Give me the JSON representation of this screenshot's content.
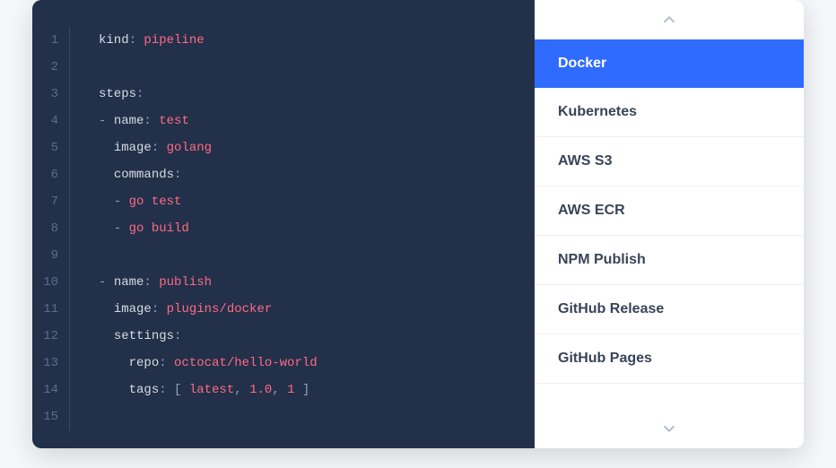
{
  "editor": {
    "lines": [
      [
        {
          "t": "key",
          "v": "kind"
        },
        {
          "t": "punc",
          "v": ": "
        },
        {
          "t": "val",
          "v": "pipeline"
        }
      ],
      [],
      [
        {
          "t": "key",
          "v": "steps"
        },
        {
          "t": "punc",
          "v": ":"
        }
      ],
      [
        {
          "t": "dash",
          "v": "- "
        },
        {
          "t": "key",
          "v": "name"
        },
        {
          "t": "punc",
          "v": ": "
        },
        {
          "t": "val",
          "v": "test"
        }
      ],
      [
        {
          "t": "pad",
          "v": "  "
        },
        {
          "t": "key",
          "v": "image"
        },
        {
          "t": "punc",
          "v": ": "
        },
        {
          "t": "val",
          "v": "golang"
        }
      ],
      [
        {
          "t": "pad",
          "v": "  "
        },
        {
          "t": "key",
          "v": "commands"
        },
        {
          "t": "punc",
          "v": ":"
        }
      ],
      [
        {
          "t": "pad",
          "v": "  "
        },
        {
          "t": "dash",
          "v": "- "
        },
        {
          "t": "val",
          "v": "go test"
        }
      ],
      [
        {
          "t": "pad",
          "v": "  "
        },
        {
          "t": "dash",
          "v": "- "
        },
        {
          "t": "val",
          "v": "go build"
        }
      ],
      [],
      [
        {
          "t": "dash",
          "v": "- "
        },
        {
          "t": "key",
          "v": "name"
        },
        {
          "t": "punc",
          "v": ": "
        },
        {
          "t": "val",
          "v": "publish"
        }
      ],
      [
        {
          "t": "pad",
          "v": "  "
        },
        {
          "t": "key",
          "v": "image"
        },
        {
          "t": "punc",
          "v": ": "
        },
        {
          "t": "val",
          "v": "plugins/docker"
        }
      ],
      [
        {
          "t": "pad",
          "v": "  "
        },
        {
          "t": "key",
          "v": "settings"
        },
        {
          "t": "punc",
          "v": ":"
        }
      ],
      [
        {
          "t": "pad",
          "v": "    "
        },
        {
          "t": "key",
          "v": "repo"
        },
        {
          "t": "punc",
          "v": ": "
        },
        {
          "t": "val",
          "v": "octocat/hello-world"
        }
      ],
      [
        {
          "t": "pad",
          "v": "    "
        },
        {
          "t": "key",
          "v": "tags"
        },
        {
          "t": "punc",
          "v": ": [ "
        },
        {
          "t": "val",
          "v": "latest"
        },
        {
          "t": "punc",
          "v": ", "
        },
        {
          "t": "val",
          "v": "1.0"
        },
        {
          "t": "punc",
          "v": ", "
        },
        {
          "t": "val",
          "v": "1"
        },
        {
          "t": "punc",
          "v": " ]"
        }
      ],
      []
    ]
  },
  "sidebar": {
    "items": [
      {
        "label": "Docker",
        "active": true
      },
      {
        "label": "Kubernetes",
        "active": false
      },
      {
        "label": "AWS S3",
        "active": false
      },
      {
        "label": "AWS ECR",
        "active": false
      },
      {
        "label": "NPM Publish",
        "active": false
      },
      {
        "label": "GitHub Release",
        "active": false
      },
      {
        "label": "GitHub Pages",
        "active": false
      }
    ]
  }
}
